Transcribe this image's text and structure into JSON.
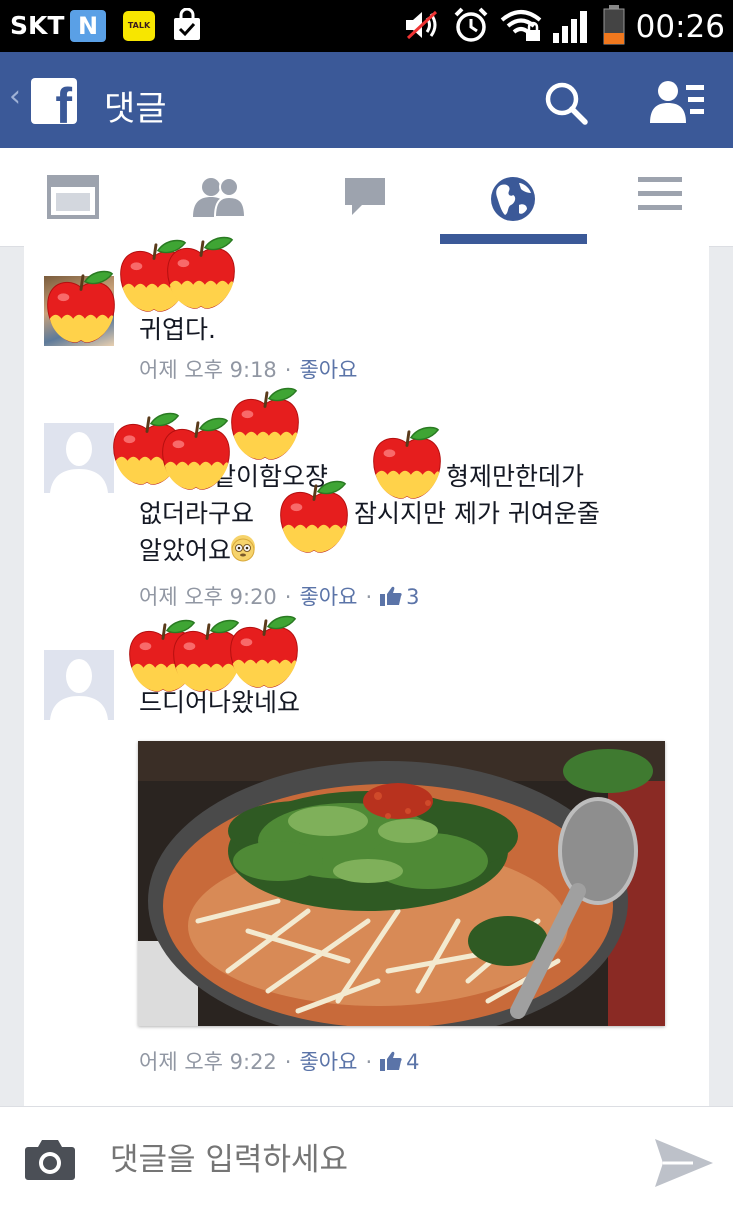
{
  "status_bar": {
    "carrier": "SKT",
    "n_icon": "N",
    "talk_icon": "TALK",
    "time": "00:26"
  },
  "header": {
    "title": "댓글"
  },
  "tabs": [
    {
      "name": "news-feed"
    },
    {
      "name": "friends"
    },
    {
      "name": "messages"
    },
    {
      "name": "notifications",
      "active": true
    },
    {
      "name": "more"
    }
  ],
  "comments": [
    {
      "text": "귀엽다.",
      "time": "어제 오후 9:18",
      "like_label": "좋아요"
    },
    {
      "text_line1": "같이함오쟝",
      "text_line1b": "형제만한데가",
      "text_line2": "없더라구요",
      "text_line2b": "잠시지만 제가 귀여운줄",
      "text_line3": "알았어요",
      "time": "어제 오후 9:20",
      "like_label": "좋아요",
      "likes": "3"
    },
    {
      "text": "드디어나왔네요",
      "time": "어제 오후 9:22",
      "like_label": "좋아요",
      "likes": "4"
    }
  ],
  "input": {
    "placeholder": "댓글을 입력하세요"
  },
  "colors": {
    "brand": "#3b5998",
    "like_link": "#5b74a8",
    "meta_gray": "#9197a3"
  }
}
